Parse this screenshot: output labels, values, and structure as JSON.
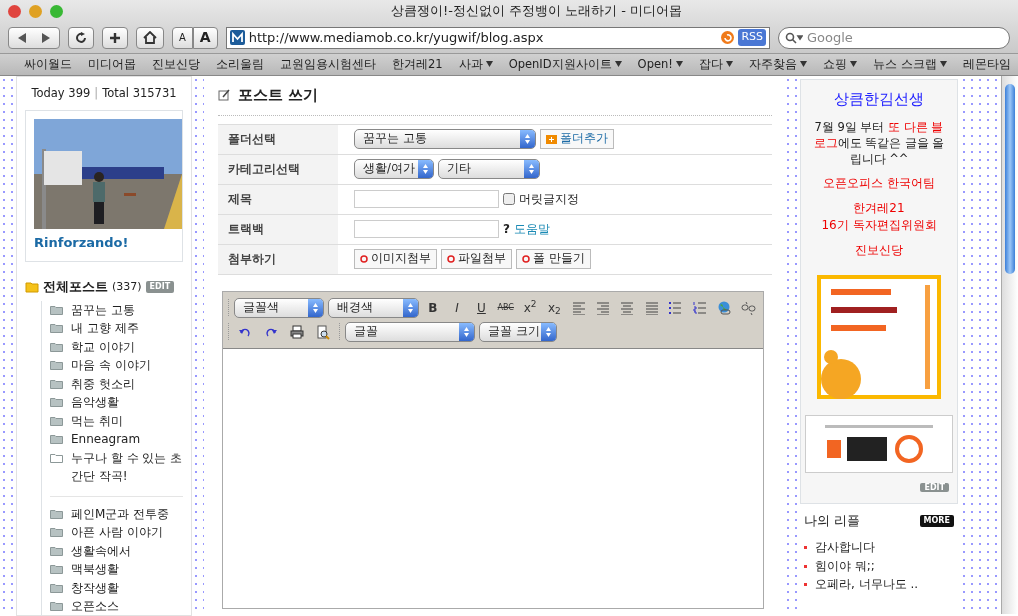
{
  "window": {
    "title": "상큼쟁이!-정신없이 주정뱅이 노래하기 - 미디어몹"
  },
  "toolbar": {
    "text_small": "A",
    "text_large": "A",
    "url": "http://www.mediamob.co.kr/yugwif/blog.aspx",
    "rss": "RSS",
    "search_placeholder": "Google"
  },
  "bookmarks": [
    {
      "label": "싸이월드",
      "menu": false
    },
    {
      "label": "미디어몹",
      "menu": false
    },
    {
      "label": "진보신당",
      "menu": false
    },
    {
      "label": "소리울림",
      "menu": false
    },
    {
      "label": "교원임용시험센타",
      "menu": false
    },
    {
      "label": "한겨레21",
      "menu": false
    },
    {
      "label": "사과",
      "menu": true
    },
    {
      "label": "OpenID지원사이트",
      "menu": true
    },
    {
      "label": "Open!",
      "menu": true
    },
    {
      "label": "잡다",
      "menu": true
    },
    {
      "label": "자주찾음",
      "menu": true
    },
    {
      "label": "쇼핑",
      "menu": true
    },
    {
      "label": "뉴스 스크랩",
      "menu": true
    },
    {
      "label": "레몬타임",
      "menu": false
    }
  ],
  "sidebar": {
    "today_label": "Today",
    "today": "399",
    "separator": "|",
    "total_label": "Total",
    "total": "315731",
    "profile_picture": {
      "kind": "picture"
    },
    "profile_name": "Rinforzando!",
    "category_header": {
      "name": "전체포스트",
      "count": "(337)",
      "edit": "EDIT"
    },
    "category_groups": [
      [
        {
          "name": "꿈꾸는 고통",
          "empty": false
        },
        {
          "name": "내 고향 제주",
          "empty": false
        },
        {
          "name": "학교 이야기",
          "empty": false
        },
        {
          "name": "마음 속 이야기",
          "empty": false
        },
        {
          "name": "취중 헛소리",
          "empty": false
        },
        {
          "name": "음악생활",
          "empty": false
        },
        {
          "name": "먹는 취미",
          "empty": false
        },
        {
          "name": "Enneagram",
          "empty": false
        },
        {
          "name": "누구나 할 수 있는 초 간단 작곡!",
          "empty": true
        }
      ],
      [
        {
          "name": "페인M군과 전투중",
          "empty": false
        },
        {
          "name": "아픈 사람 이야기",
          "empty": false
        },
        {
          "name": "생활속에서",
          "empty": false
        },
        {
          "name": "맥북생활",
          "empty": false
        },
        {
          "name": "창작생활",
          "empty": false
        },
        {
          "name": "오픈소스",
          "empty": false
        }
      ]
    ]
  },
  "post_form": {
    "title": "포스트 쓰기",
    "rows": [
      {
        "kind": "folder",
        "label": "폴더선택",
        "select": "꿈꾸는 고통",
        "button": "폴더추가"
      },
      {
        "kind": "category",
        "label": "카테고리선택",
        "selects": [
          "생활/여가",
          "기타"
        ]
      },
      {
        "kind": "title",
        "label": "제목",
        "checkbox_label": "머릿글지정",
        "checked": false
      },
      {
        "kind": "trackback",
        "label": "트랙백",
        "hint": "?",
        "link": "도움말"
      },
      {
        "kind": "attach",
        "label": "첨부하기",
        "buttons": [
          "이미지첨부",
          "파일첨부",
          "폴 만들기"
        ]
      }
    ]
  },
  "editor": {
    "font_color": "글꼴색",
    "background_color": "배경색",
    "format_buttons": [
      "B",
      "I",
      "U",
      "ABC",
      "x$^{2}$",
      "x$_{2}$"
    ],
    "font": "글꼴",
    "font_size": "글꼴 크기"
  },
  "right_sidebar": {
    "title": "상큼한김선생",
    "notice": [
      {
        "text": "7월 9일 부터 ",
        "highlight": false
      },
      {
        "text": "또 다른 블로그",
        "highlight": true
      },
      {
        "text": "에도 똑같은 글을 올립니다 ^^",
        "highlight": false
      }
    ],
    "links": [
      [
        "오픈오피스 한국어팀"
      ],
      [
        "한겨레21",
        "16기 독자편집위원회"
      ],
      [
        "진보신당"
      ]
    ],
    "banners": [
      {
        "kind": "picture"
      },
      {
        "kind": "picture"
      }
    ],
    "edit": "EDIT",
    "replies_title": "나의 리플",
    "more": "MORE",
    "replies": [
      "감사합니다",
      "힘이야 뭐;;",
      "오페라, 너무나도 .."
    ]
  }
}
